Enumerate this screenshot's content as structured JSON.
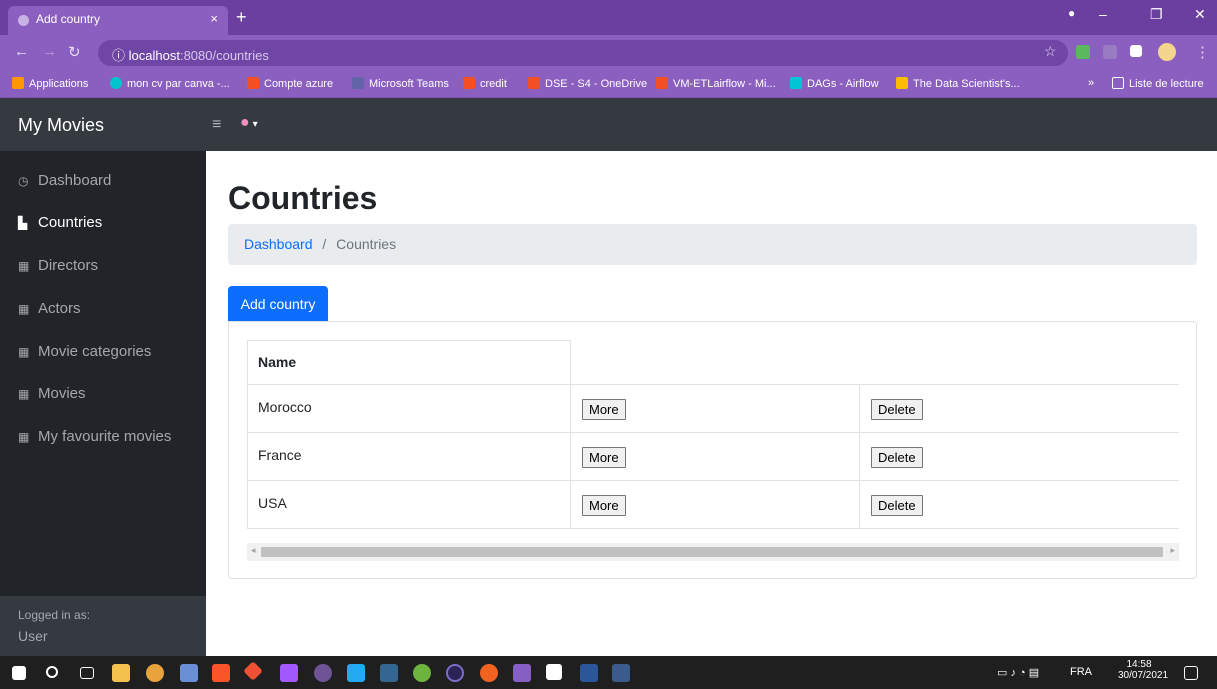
{
  "browser": {
    "tab_title": "Add country",
    "tab_close": "×",
    "new_tab": "+",
    "address_host": "localhost",
    "address_path": ":8080/countries",
    "info_icon": "ⓘ",
    "star": "☆"
  },
  "bookmarks": {
    "items": [
      {
        "label": "Applications",
        "color": "#ff9800"
      },
      {
        "label": "mon cv par canva -...",
        "color": "#00c4cc"
      },
      {
        "label": "Compte azure",
        "color": "#f25022"
      },
      {
        "label": "Microsoft Teams",
        "color": "#6264a7"
      },
      {
        "label": "credit",
        "color": "#f25022"
      },
      {
        "label": "DSE - S4 - OneDrive",
        "color": "#f25022"
      },
      {
        "label": "VM-ETLairflow - Mi...",
        "color": "#f25022"
      },
      {
        "label": "DAGs - Airflow",
        "color": "#00c7d4"
      },
      {
        "label": "The Data Scientist's...",
        "color": "#fbbc04"
      }
    ],
    "more": "»",
    "reading_list": "Liste de lecture"
  },
  "app": {
    "brand": "My Movies",
    "hamburger": "≡",
    "user_icon": "▾"
  },
  "sidebar": {
    "items": [
      {
        "label": "Dashboard",
        "icon": "dashboard-icon",
        "glyph": "◷"
      },
      {
        "label": "Countries",
        "icon": "chart-area-icon",
        "glyph": "▙"
      },
      {
        "label": "Directors",
        "icon": "table-icon",
        "glyph": "▦"
      },
      {
        "label": "Actors",
        "icon": "table-icon",
        "glyph": "▦"
      },
      {
        "label": "Movie categories",
        "icon": "table-icon",
        "glyph": "▦"
      },
      {
        "label": "Movies",
        "icon": "table-icon",
        "glyph": "▦"
      },
      {
        "label": "My favourite movies",
        "icon": "table-icon",
        "glyph": "▦"
      }
    ],
    "active_index": 1,
    "footer_label": "Logged in as:",
    "footer_user": "User"
  },
  "main": {
    "title": "Countries",
    "breadcrumb_home": "Dashboard",
    "breadcrumb_sep": "/",
    "breadcrumb_current": "Countries",
    "add_button": "Add country",
    "table": {
      "header": "Name",
      "more_label": "More",
      "delete_label": "Delete",
      "rows": [
        "Morocco",
        "France",
        "USA"
      ]
    }
  },
  "taskbar": {
    "lang": "FRA",
    "time": "14:58",
    "date": "30/07/2021"
  }
}
